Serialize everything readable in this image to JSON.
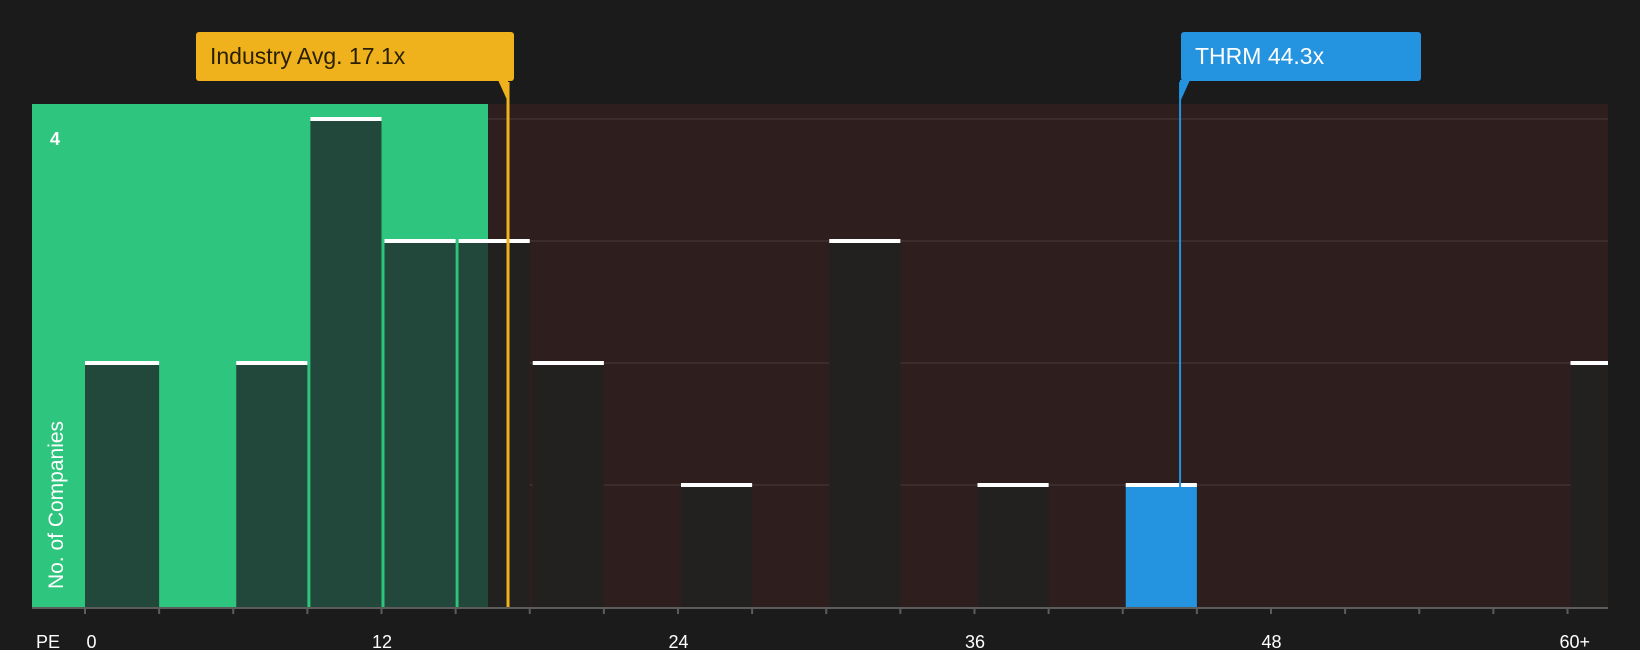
{
  "chart_data": {
    "type": "bar",
    "metric_label": "PE",
    "ylabel": "No. of Companies",
    "y_tick_labels": [
      "4"
    ],
    "ylim": [
      0,
      4
    ],
    "x_tick_labels": [
      "0",
      "12",
      "24",
      "36",
      "48",
      "60+"
    ],
    "bins": [
      {
        "start": 0,
        "value": 2
      },
      {
        "start": 6,
        "value": 2
      },
      {
        "start": 9,
        "value": 4
      },
      {
        "start": 12,
        "value": 3
      },
      {
        "start": 15,
        "value": 3
      },
      {
        "start": 18,
        "value": 2
      },
      {
        "start": 24,
        "value": 1
      },
      {
        "start": 30,
        "value": 3
      },
      {
        "start": 36,
        "value": 1
      },
      {
        "start": 42,
        "value": 1,
        "highlight": true
      },
      {
        "start": 60,
        "value": 2
      }
    ],
    "bin_width": 3,
    "industry_avg": {
      "label": "Industry Avg. 17.1x",
      "value": 17.1
    },
    "company": {
      "label": "THRM 44.3x",
      "value": 44.3
    },
    "colors": {
      "green_zone": "#2ec67e",
      "red_zone": "#2e1e1e",
      "bar_in_green": "#21483a",
      "bar_in_red": "#232020",
      "bar_highlight": "#2494e0",
      "avg": "#efb21d",
      "company": "#2494e0"
    }
  }
}
